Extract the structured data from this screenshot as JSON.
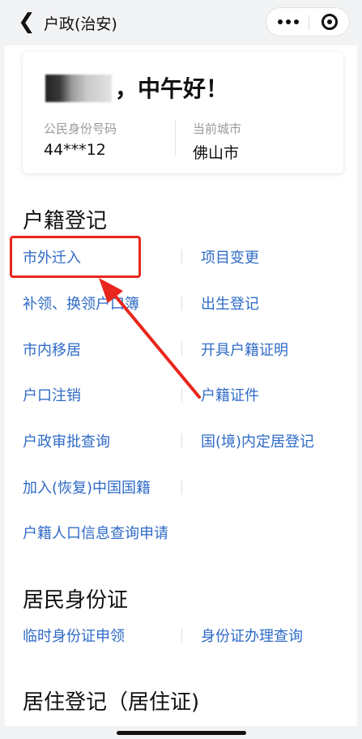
{
  "nav": {
    "back_icon": "chevron-left-icon",
    "title": "户政(治安)",
    "more_icon": "more-dots-icon",
    "close_icon": "target-close-icon"
  },
  "card": {
    "greeting": "，中午好！",
    "id_label": "公民身份号码",
    "id_value": "44***12",
    "city_label": "当前城市",
    "city_value": "佛山市"
  },
  "sections": [
    {
      "title": "户籍登记",
      "items": [
        "市外迁入",
        "项目变更",
        "补领、换领户口簿",
        "出生登记",
        "市内移居",
        "开具户籍证明",
        "户口注销",
        "户籍证件",
        "户政审批查询",
        "国(境)内定居登记",
        "加入(恢复)中国国籍",
        "户籍人口信息查询申请"
      ]
    },
    {
      "title": "居民身份证",
      "items": [
        "临时身份证申领",
        "身份证办理查询"
      ]
    },
    {
      "title": "居住登记（居住证)",
      "items": []
    }
  ],
  "colors": {
    "link": "#2f6bc7",
    "highlight": "#e8261c",
    "background": "#f2f3f5"
  }
}
